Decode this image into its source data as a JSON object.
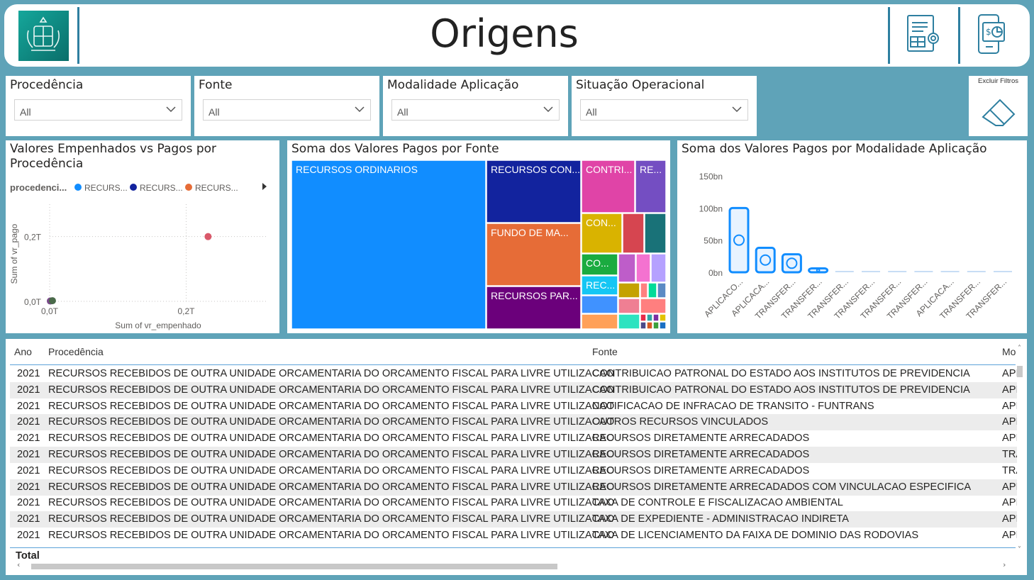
{
  "header": {
    "title": "Origens"
  },
  "slicers": [
    {
      "title": "Procedência",
      "value": "All"
    },
    {
      "title": "Fonte",
      "value": "All"
    },
    {
      "title": "Modalidade Aplicação",
      "value": "All"
    },
    {
      "title": "Situação Operacional",
      "value": "All"
    }
  ],
  "clear_filters": {
    "label": "Excluir Filtros"
  },
  "scatter": {
    "title": "Valores Empenhados vs Pagos por Procedência",
    "legend_title": "procedenci...",
    "chart_data": {
      "type": "scatter",
      "title": "Valores Empenhados vs Pagos por Procedência",
      "xlabel": "Sum of vr_empenhado",
      "ylabel": "Sum of vr_pago",
      "x_ticks": [
        "0,0T",
        "0,2T"
      ],
      "y_ticks": [
        "0,2T",
        "0,0T"
      ],
      "legend": "top",
      "series": [
        {
          "name": "RECURS...",
          "color": "#118dff",
          "x": 0.001,
          "y": 0.001
        },
        {
          "name": "RECURS...",
          "color": "#12239e",
          "x": 0.002,
          "y": 0.002
        },
        {
          "name": "RECURS...",
          "color": "#e66c37",
          "x": 0.23,
          "y": 0.2
        }
      ],
      "xlim": [
        0,
        0.32
      ],
      "ylim": [
        0,
        0.3
      ],
      "grid": true
    }
  },
  "treemap": {
    "title": "Soma dos Valores Pagos por Fonte",
    "chart_data": {
      "type": "treemap",
      "title": "Soma dos Valores Pagos por Fonte",
      "labels": [
        "RECURSOS ORDINARIOS",
        "RECURSOS CON...",
        "FUNDO DE MA...",
        "RECURSOS PAR...",
        "CONTRI...",
        "RE...",
        "CON...",
        "CO...",
        "REC..."
      ]
    }
  },
  "barchart": {
    "title": "Soma dos Valores Pagos por Modalidade Aplicação",
    "chart_data": {
      "type": "bar",
      "title": "Soma dos Valores Pagos por Modalidade Aplicação",
      "categories": [
        "APLICACO...",
        "APLICACA...",
        "TRANSFER...",
        "TRANSFER...",
        "TRANSFER...",
        "TRANSFER...",
        "TRANSFER...",
        "TRANSFER...",
        "APLICACA...",
        "TRANSFER...",
        "TRANSFER..."
      ],
      "values": [
        100,
        38,
        28,
        6,
        0.5,
        0.3,
        0.2,
        0.1,
        0.1,
        0.05,
        0.05
      ],
      "y_ticks": [
        "150bn",
        "100bn",
        "50bn",
        "0bn"
      ],
      "ylim": [
        0,
        150
      ],
      "grid": false
    }
  },
  "table": {
    "headers": [
      "Ano",
      "Procedência",
      "Fonte",
      "Mo"
    ],
    "rows": [
      [
        "2021",
        "RECURSOS RECEBIDOS DE OUTRA UNIDADE ORCAMENTARIA DO ORCAMENTO FISCAL PARA LIVRE UTILIZACAO",
        "CONTRIBUICAO PATRONAL DO ESTADO AOS INSTITUTOS DE PREVIDENCIA",
        "API"
      ],
      [
        "2021",
        "RECURSOS RECEBIDOS DE OUTRA UNIDADE ORCAMENTARIA DO ORCAMENTO FISCAL PARA LIVRE UTILIZACAO",
        "CONTRIBUICAO PATRONAL DO ESTADO AOS INSTITUTOS DE PREVIDENCIA",
        "API"
      ],
      [
        "2021",
        "RECURSOS RECEBIDOS DE OUTRA UNIDADE ORCAMENTARIA DO ORCAMENTO FISCAL PARA LIVRE UTILIZACAO",
        "NOTIFICACAO DE INFRACAO DE TRANSITO - FUNTRANS",
        "API"
      ],
      [
        "2021",
        "RECURSOS RECEBIDOS DE OUTRA UNIDADE ORCAMENTARIA DO ORCAMENTO FISCAL PARA LIVRE UTILIZACAO",
        "OUTROS RECURSOS VINCULADOS",
        "API"
      ],
      [
        "2021",
        "RECURSOS RECEBIDOS DE OUTRA UNIDADE ORCAMENTARIA DO ORCAMENTO FISCAL PARA LIVRE UTILIZACAO",
        "RECURSOS DIRETAMENTE ARRECADADOS",
        "API"
      ],
      [
        "2021",
        "RECURSOS RECEBIDOS DE OUTRA UNIDADE ORCAMENTARIA DO ORCAMENTO FISCAL PARA LIVRE UTILIZACAO",
        "RECURSOS DIRETAMENTE ARRECADADOS",
        "TRA"
      ],
      [
        "2021",
        "RECURSOS RECEBIDOS DE OUTRA UNIDADE ORCAMENTARIA DO ORCAMENTO FISCAL PARA LIVRE UTILIZACAO",
        "RECURSOS DIRETAMENTE ARRECADADOS",
        "TRA"
      ],
      [
        "2021",
        "RECURSOS RECEBIDOS DE OUTRA UNIDADE ORCAMENTARIA DO ORCAMENTO FISCAL PARA LIVRE UTILIZACAO",
        "RECURSOS DIRETAMENTE ARRECADADOS COM VINCULACAO ESPECIFICA",
        "API"
      ],
      [
        "2021",
        "RECURSOS RECEBIDOS DE OUTRA UNIDADE ORCAMENTARIA DO ORCAMENTO FISCAL PARA LIVRE UTILIZACAO",
        "TAXA DE CONTROLE E FISCALIZACAO AMBIENTAL",
        "API"
      ],
      [
        "2021",
        "RECURSOS RECEBIDOS DE OUTRA UNIDADE ORCAMENTARIA DO ORCAMENTO FISCAL PARA LIVRE UTILIZACAO",
        "TAXA DE EXPEDIENTE - ADMINISTRACAO INDIRETA",
        "API"
      ],
      [
        "2021",
        "RECURSOS RECEBIDOS DE OUTRA UNIDADE ORCAMENTARIA DO ORCAMENTO FISCAL PARA LIVRE UTILIZACAO",
        "TAXA DE LICENCIAMENTO DA FAIXA DE DOMINIO DAS RODOVIAS",
        "API"
      ]
    ],
    "total_label": "Total"
  }
}
